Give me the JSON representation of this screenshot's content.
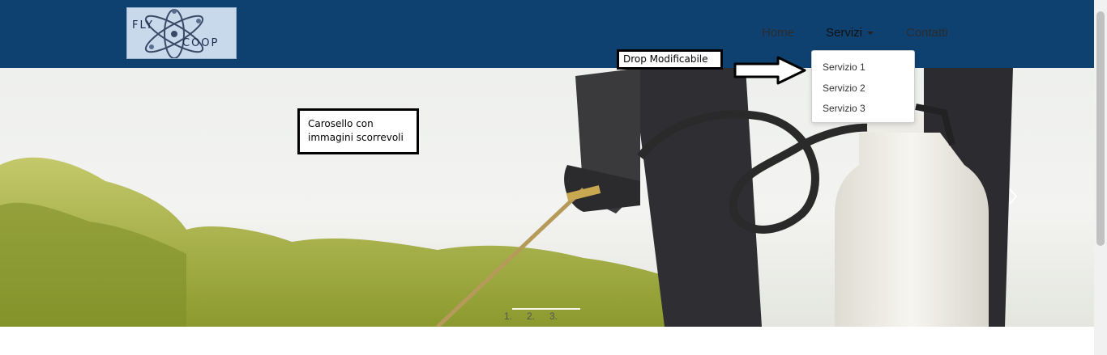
{
  "header": {
    "logo": {
      "text_top": "FLY",
      "text_bottom": "COOP"
    },
    "nav": [
      {
        "label": "Home"
      },
      {
        "label": "Servizi"
      },
      {
        "label": "Contatti"
      }
    ]
  },
  "dropdown": {
    "items": [
      {
        "label": "Servizio 1"
      },
      {
        "label": "Servizio 2"
      },
      {
        "label": "Servizio 3"
      }
    ]
  },
  "annotations": {
    "drop": "Drop Modificabile",
    "carousel_line1": "Carosello con",
    "carousel_line2": "immagini scorrevoli"
  },
  "carousel": {
    "indicators": [
      "1.",
      "2.",
      "3."
    ]
  },
  "colors": {
    "navbar": "#0f4170",
    "foliage": "#a7b23a",
    "glove": "#3b3b3b",
    "tank": "#f2f1ea"
  }
}
